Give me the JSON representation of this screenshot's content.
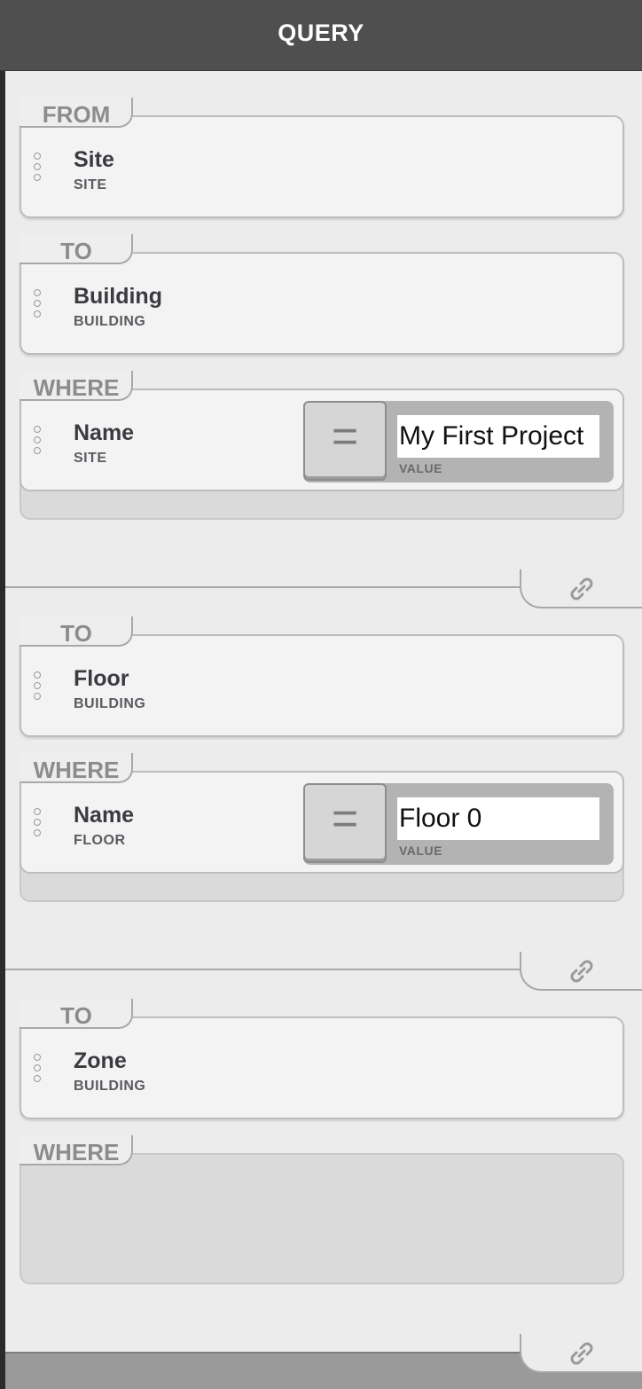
{
  "header": {
    "title": "QUERY"
  },
  "blocks": [
    {
      "label": "FROM",
      "entity": {
        "name": "Site",
        "type": "SITE"
      }
    },
    {
      "label": "TO",
      "entity": {
        "name": "Building",
        "type": "BUILDING"
      }
    },
    {
      "label": "WHERE",
      "condition": {
        "field": "Name",
        "type": "SITE",
        "operator": "=",
        "value": "My First Project",
        "value_label": "VALUE"
      }
    },
    {
      "label": "TO",
      "entity": {
        "name": "Floor",
        "type": "BUILDING"
      }
    },
    {
      "label": "WHERE",
      "condition": {
        "field": "Name",
        "type": "FLOOR",
        "operator": "=",
        "value": "Floor 0",
        "value_label": "VALUE"
      }
    },
    {
      "label": "TO",
      "entity": {
        "name": "Zone",
        "type": "BUILDING"
      }
    },
    {
      "label": "WHERE"
    }
  ],
  "icons": {
    "link": "link-icon",
    "handle": "drag-handle-icon"
  },
  "colors": {
    "header_bg": "#4f4f4f",
    "panel_bg": "#ececec",
    "card_bg": "#f3f3f3",
    "label_gray": "#8c8c8c"
  }
}
